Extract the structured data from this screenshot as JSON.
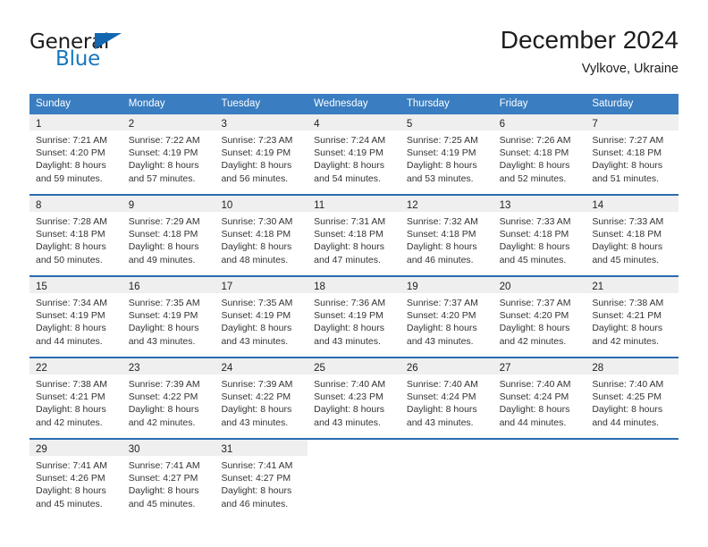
{
  "brand": {
    "name_part1": "General",
    "name_part2": "Blue",
    "flag_icon": "triangle-flag-icon",
    "accent_color": "#1267b0"
  },
  "header": {
    "title": "December 2024",
    "location": "Vylkove, Ukraine"
  },
  "theme": {
    "header_blue": "#3a7dc0",
    "row_border_blue": "#2a6cb0",
    "daynum_band_gray": "#efefef"
  },
  "weekdays": [
    "Sunday",
    "Monday",
    "Tuesday",
    "Wednesday",
    "Thursday",
    "Friday",
    "Saturday"
  ],
  "weeks": [
    [
      {
        "day": "1",
        "sunrise": "Sunrise: 7:21 AM",
        "sunset": "Sunset: 4:20 PM",
        "daylight1": "Daylight: 8 hours",
        "daylight2": "and 59 minutes."
      },
      {
        "day": "2",
        "sunrise": "Sunrise: 7:22 AM",
        "sunset": "Sunset: 4:19 PM",
        "daylight1": "Daylight: 8 hours",
        "daylight2": "and 57 minutes."
      },
      {
        "day": "3",
        "sunrise": "Sunrise: 7:23 AM",
        "sunset": "Sunset: 4:19 PM",
        "daylight1": "Daylight: 8 hours",
        "daylight2": "and 56 minutes."
      },
      {
        "day": "4",
        "sunrise": "Sunrise: 7:24 AM",
        "sunset": "Sunset: 4:19 PM",
        "daylight1": "Daylight: 8 hours",
        "daylight2": "and 54 minutes."
      },
      {
        "day": "5",
        "sunrise": "Sunrise: 7:25 AM",
        "sunset": "Sunset: 4:19 PM",
        "daylight1": "Daylight: 8 hours",
        "daylight2": "and 53 minutes."
      },
      {
        "day": "6",
        "sunrise": "Sunrise: 7:26 AM",
        "sunset": "Sunset: 4:18 PM",
        "daylight1": "Daylight: 8 hours",
        "daylight2": "and 52 minutes."
      },
      {
        "day": "7",
        "sunrise": "Sunrise: 7:27 AM",
        "sunset": "Sunset: 4:18 PM",
        "daylight1": "Daylight: 8 hours",
        "daylight2": "and 51 minutes."
      }
    ],
    [
      {
        "day": "8",
        "sunrise": "Sunrise: 7:28 AM",
        "sunset": "Sunset: 4:18 PM",
        "daylight1": "Daylight: 8 hours",
        "daylight2": "and 50 minutes."
      },
      {
        "day": "9",
        "sunrise": "Sunrise: 7:29 AM",
        "sunset": "Sunset: 4:18 PM",
        "daylight1": "Daylight: 8 hours",
        "daylight2": "and 49 minutes."
      },
      {
        "day": "10",
        "sunrise": "Sunrise: 7:30 AM",
        "sunset": "Sunset: 4:18 PM",
        "daylight1": "Daylight: 8 hours",
        "daylight2": "and 48 minutes."
      },
      {
        "day": "11",
        "sunrise": "Sunrise: 7:31 AM",
        "sunset": "Sunset: 4:18 PM",
        "daylight1": "Daylight: 8 hours",
        "daylight2": "and 47 minutes."
      },
      {
        "day": "12",
        "sunrise": "Sunrise: 7:32 AM",
        "sunset": "Sunset: 4:18 PM",
        "daylight1": "Daylight: 8 hours",
        "daylight2": "and 46 minutes."
      },
      {
        "day": "13",
        "sunrise": "Sunrise: 7:33 AM",
        "sunset": "Sunset: 4:18 PM",
        "daylight1": "Daylight: 8 hours",
        "daylight2": "and 45 minutes."
      },
      {
        "day": "14",
        "sunrise": "Sunrise: 7:33 AM",
        "sunset": "Sunset: 4:18 PM",
        "daylight1": "Daylight: 8 hours",
        "daylight2": "and 45 minutes."
      }
    ],
    [
      {
        "day": "15",
        "sunrise": "Sunrise: 7:34 AM",
        "sunset": "Sunset: 4:19 PM",
        "daylight1": "Daylight: 8 hours",
        "daylight2": "and 44 minutes."
      },
      {
        "day": "16",
        "sunrise": "Sunrise: 7:35 AM",
        "sunset": "Sunset: 4:19 PM",
        "daylight1": "Daylight: 8 hours",
        "daylight2": "and 43 minutes."
      },
      {
        "day": "17",
        "sunrise": "Sunrise: 7:35 AM",
        "sunset": "Sunset: 4:19 PM",
        "daylight1": "Daylight: 8 hours",
        "daylight2": "and 43 minutes."
      },
      {
        "day": "18",
        "sunrise": "Sunrise: 7:36 AM",
        "sunset": "Sunset: 4:19 PM",
        "daylight1": "Daylight: 8 hours",
        "daylight2": "and 43 minutes."
      },
      {
        "day": "19",
        "sunrise": "Sunrise: 7:37 AM",
        "sunset": "Sunset: 4:20 PM",
        "daylight1": "Daylight: 8 hours",
        "daylight2": "and 43 minutes."
      },
      {
        "day": "20",
        "sunrise": "Sunrise: 7:37 AM",
        "sunset": "Sunset: 4:20 PM",
        "daylight1": "Daylight: 8 hours",
        "daylight2": "and 42 minutes."
      },
      {
        "day": "21",
        "sunrise": "Sunrise: 7:38 AM",
        "sunset": "Sunset: 4:21 PM",
        "daylight1": "Daylight: 8 hours",
        "daylight2": "and 42 minutes."
      }
    ],
    [
      {
        "day": "22",
        "sunrise": "Sunrise: 7:38 AM",
        "sunset": "Sunset: 4:21 PM",
        "daylight1": "Daylight: 8 hours",
        "daylight2": "and 42 minutes."
      },
      {
        "day": "23",
        "sunrise": "Sunrise: 7:39 AM",
        "sunset": "Sunset: 4:22 PM",
        "daylight1": "Daylight: 8 hours",
        "daylight2": "and 42 minutes."
      },
      {
        "day": "24",
        "sunrise": "Sunrise: 7:39 AM",
        "sunset": "Sunset: 4:22 PM",
        "daylight1": "Daylight: 8 hours",
        "daylight2": "and 43 minutes."
      },
      {
        "day": "25",
        "sunrise": "Sunrise: 7:40 AM",
        "sunset": "Sunset: 4:23 PM",
        "daylight1": "Daylight: 8 hours",
        "daylight2": "and 43 minutes."
      },
      {
        "day": "26",
        "sunrise": "Sunrise: 7:40 AM",
        "sunset": "Sunset: 4:24 PM",
        "daylight1": "Daylight: 8 hours",
        "daylight2": "and 43 minutes."
      },
      {
        "day": "27",
        "sunrise": "Sunrise: 7:40 AM",
        "sunset": "Sunset: 4:24 PM",
        "daylight1": "Daylight: 8 hours",
        "daylight2": "and 44 minutes."
      },
      {
        "day": "28",
        "sunrise": "Sunrise: 7:40 AM",
        "sunset": "Sunset: 4:25 PM",
        "daylight1": "Daylight: 8 hours",
        "daylight2": "and 44 minutes."
      }
    ],
    [
      {
        "day": "29",
        "sunrise": "Sunrise: 7:41 AM",
        "sunset": "Sunset: 4:26 PM",
        "daylight1": "Daylight: 8 hours",
        "daylight2": "and 45 minutes."
      },
      {
        "day": "30",
        "sunrise": "Sunrise: 7:41 AM",
        "sunset": "Sunset: 4:27 PM",
        "daylight1": "Daylight: 8 hours",
        "daylight2": "and 45 minutes."
      },
      {
        "day": "31",
        "sunrise": "Sunrise: 7:41 AM",
        "sunset": "Sunset: 4:27 PM",
        "daylight1": "Daylight: 8 hours",
        "daylight2": "and 46 minutes."
      },
      {
        "day": "",
        "sunrise": "",
        "sunset": "",
        "daylight1": "",
        "daylight2": ""
      },
      {
        "day": "",
        "sunrise": "",
        "sunset": "",
        "daylight1": "",
        "daylight2": ""
      },
      {
        "day": "",
        "sunrise": "",
        "sunset": "",
        "daylight1": "",
        "daylight2": ""
      },
      {
        "day": "",
        "sunrise": "",
        "sunset": "",
        "daylight1": "",
        "daylight2": ""
      }
    ]
  ]
}
